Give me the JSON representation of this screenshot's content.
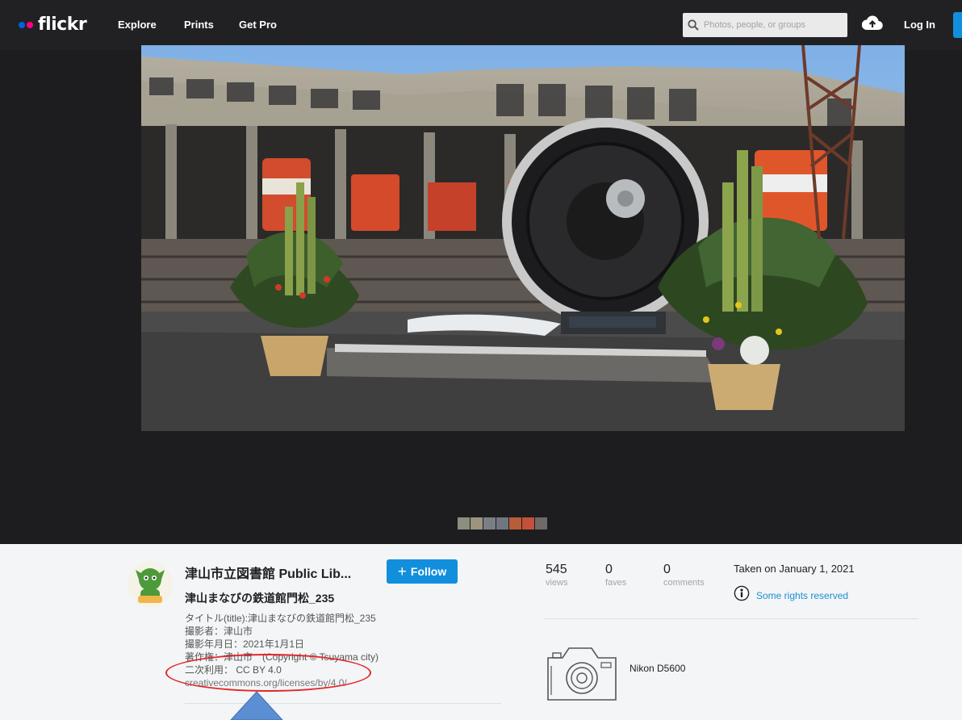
{
  "header": {
    "logo_text": "flickr",
    "nav": [
      "Explore",
      "Prints",
      "Get Pro"
    ],
    "search_placeholder": "Photos, people, or groups",
    "login_label": "Log In"
  },
  "photo": {
    "alt": "津山まなびの鉄道館門松_235",
    "thumbnail_count": 7
  },
  "owner": {
    "name": "津山市立図書館 Public Lib...",
    "follow_label": "Follow"
  },
  "photo_title": "津山まなびの鉄道館門松_235",
  "description": [
    "タイトル(title):津山まなびの鉄道館門松_235",
    "撮影者：津山市",
    "撮影年月日：2021年1月1日",
    "著作権：津山市　(Copyright © Tsuyama city)",
    "二次利用： CC BY 4.0",
    "creativecommons.org/licenses/by/4.0/"
  ],
  "stats": [
    {
      "value": "545",
      "label": "views"
    },
    {
      "value": "0",
      "label": "faves"
    },
    {
      "value": "0",
      "label": "comments"
    }
  ],
  "taken": "Taken on January 1, 2021",
  "license_text": "Some rights reserved",
  "camera": "Nikon D5600",
  "colors": {
    "nav_bg": "#212124",
    "stage_bg": "#1d1d1f",
    "accent_blue": "#128fdc",
    "flickr_blue": "#0063dc",
    "flickr_pink": "#ff0084",
    "annotation_red": "#e3262c",
    "annotation_arrow": "#5b8ed3"
  }
}
